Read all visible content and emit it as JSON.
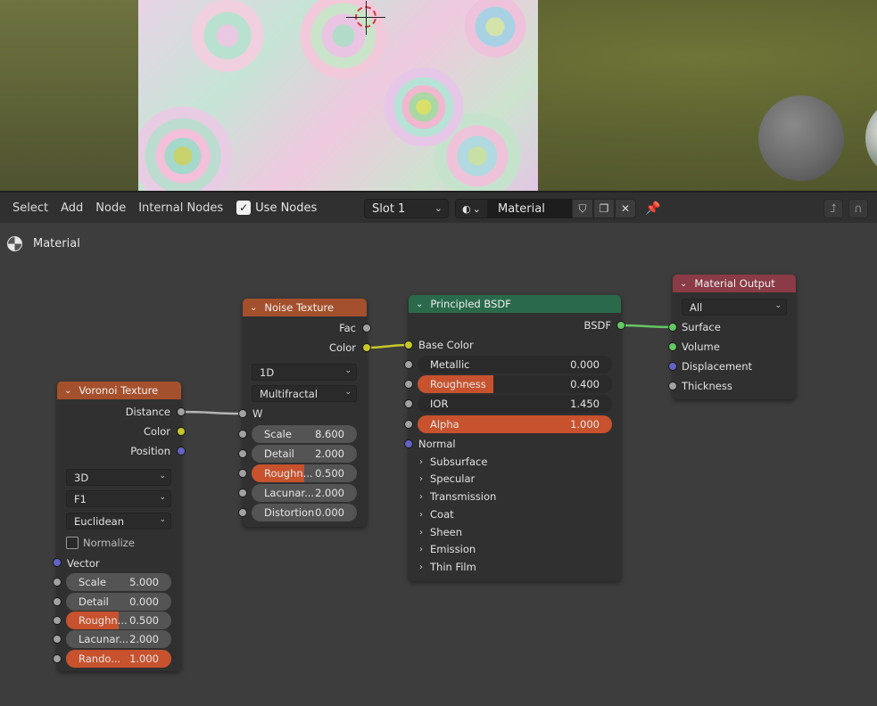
{
  "header": {
    "menus": [
      "Select",
      "Add",
      "Node",
      "Internal Nodes"
    ],
    "use_nodes_label": "Use Nodes",
    "use_nodes_checked": "✓",
    "slot": "Slot 1",
    "material_name": "Material",
    "icons": [
      "shield-icon",
      "duplicate-icon",
      "close-icon",
      "pin-icon",
      "parent-up-icon",
      "snap-icon"
    ]
  },
  "breadcrumb": {
    "label": "Material"
  },
  "nodes": {
    "voronoi": {
      "title": "Voronoi Texture",
      "outputs": [
        "Distance",
        "Color",
        "Position"
      ],
      "dimensions": "3D",
      "feature": "F1",
      "metric": "Euclidean",
      "normalize_label": "Normalize",
      "vector_label": "Vector",
      "fields": [
        {
          "label": "Scale",
          "value": "5.000"
        },
        {
          "label": "Detail",
          "value": "0.000"
        },
        {
          "label": "Roughn...",
          "value": "0.500",
          "fill": 0.5
        },
        {
          "label": "Lacunar...",
          "value": "2.000"
        },
        {
          "label": "Rando...",
          "value": "1.000",
          "fill": 1.0
        }
      ]
    },
    "noise": {
      "title": "Noise Texture",
      "outputs": [
        "Fac",
        "Color"
      ],
      "dimensions": "1D",
      "type": "Multifractal",
      "w_label": "W",
      "fields": [
        {
          "label": "Scale",
          "value": "8.600"
        },
        {
          "label": "Detail",
          "value": "2.000"
        },
        {
          "label": "Roughn...",
          "value": "0.500",
          "fill": 0.5
        },
        {
          "label": "Lacunar...",
          "value": "2.000"
        },
        {
          "label": "Distortion",
          "value": "0.000"
        }
      ]
    },
    "bsdf": {
      "title": "Principled BSDF",
      "output": "BSDF",
      "base_color_label": "Base Color",
      "fields": [
        {
          "label": "Metallic",
          "value": "0.000"
        },
        {
          "label": "Roughness",
          "value": "0.400",
          "fill": 0.4
        },
        {
          "label": "IOR",
          "value": "1.450"
        },
        {
          "label": "Alpha",
          "value": "1.000",
          "fill": 1.0
        }
      ],
      "normal_label": "Normal",
      "panels": [
        "Subsurface",
        "Specular",
        "Transmission",
        "Coat",
        "Sheen",
        "Emission",
        "Thin Film"
      ]
    },
    "output": {
      "title": "Material Output",
      "target": "All",
      "inputs": [
        "Surface",
        "Volume",
        "Displacement",
        "Thickness"
      ]
    }
  },
  "colors": {
    "texture_header": "#a5502c",
    "shader_header": "#2a6a4a",
    "output_header": "#8a3b45",
    "slider_fill": "#c7522d"
  }
}
